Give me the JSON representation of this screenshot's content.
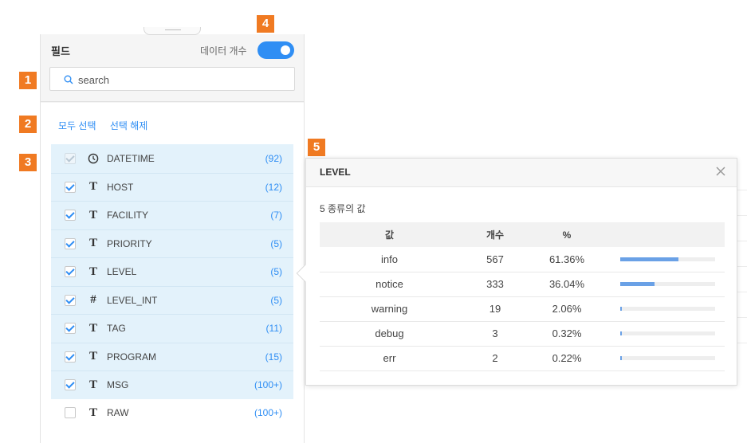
{
  "badges": [
    "1",
    "2",
    "3",
    "4",
    "5"
  ],
  "panel": {
    "title": "필드",
    "count_toggle_label": "데이터 개수",
    "count_toggle_on": true,
    "search_placeholder": "search",
    "select_all": "모두 선택",
    "deselect": "선택 해제"
  },
  "fields": [
    {
      "name": "DATETIME",
      "type_icon": "clock-icon",
      "count": "(92)",
      "checked": true,
      "disabled": true
    },
    {
      "name": "HOST",
      "type_icon": "T",
      "count": "(12)",
      "checked": true
    },
    {
      "name": "FACILITY",
      "type_icon": "T",
      "count": "(7)",
      "checked": true
    },
    {
      "name": "PRIORITY",
      "type_icon": "T",
      "count": "(5)",
      "checked": true
    },
    {
      "name": "LEVEL",
      "type_icon": "T",
      "count": "(5)",
      "checked": true
    },
    {
      "name": "LEVEL_INT",
      "type_icon": "#",
      "count": "(5)",
      "checked": true
    },
    {
      "name": "TAG",
      "type_icon": "T",
      "count": "(11)",
      "checked": true
    },
    {
      "name": "PROGRAM",
      "type_icon": "T",
      "count": "(15)",
      "checked": true
    },
    {
      "name": "MSG",
      "type_icon": "T",
      "count": "(100+)",
      "checked": true
    },
    {
      "name": "RAW",
      "type_icon": "T",
      "count": "(100+)",
      "checked": false
    }
  ],
  "popover": {
    "title": "LEVEL",
    "subtitle": "5 종류의 값",
    "columns": [
      "값",
      "개수",
      "%"
    ],
    "rows": [
      {
        "value": "info",
        "count": "567",
        "percent": "61.36%",
        "fraction": 0.6136
      },
      {
        "value": "notice",
        "count": "333",
        "percent": "36.04%",
        "fraction": 0.3604
      },
      {
        "value": "warning",
        "count": "19",
        "percent": "2.06%",
        "fraction": 0.0206
      },
      {
        "value": "debug",
        "count": "3",
        "percent": "0.32%",
        "fraction": 0.0032
      },
      {
        "value": "err",
        "count": "2",
        "percent": "0.22%",
        "fraction": 0.0022
      }
    ]
  },
  "colors": {
    "accent": "#2f8ef4",
    "badge": "#f07a22",
    "bar": "#6aa1e6",
    "selected_row": "#e3f2fb"
  }
}
